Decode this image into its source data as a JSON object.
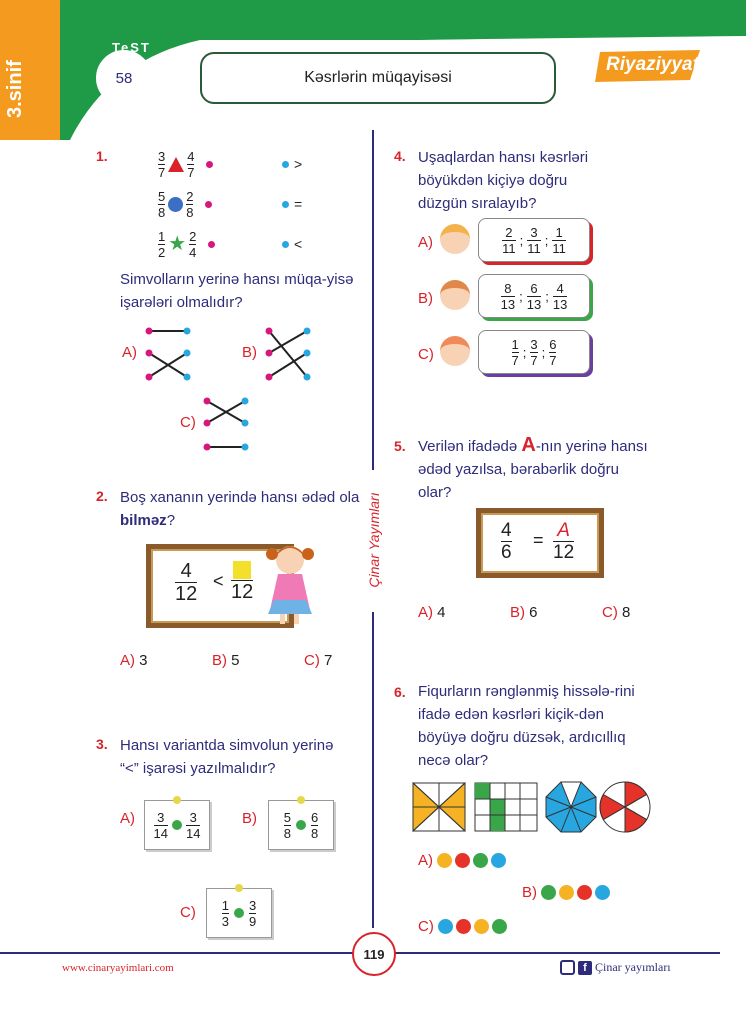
{
  "header": {
    "grade": "3.sinif",
    "test_word": "TeST",
    "test_number": "58",
    "topic": "Kəsrlərin müqayisəsi",
    "subject": "Riyaziyyat"
  },
  "side_label": "Çinar Yayımları",
  "q1": {
    "number": "1.",
    "rows": [
      {
        "l_num": "3",
        "l_den": "7",
        "r_num": "4",
        "r_den": "7",
        "shape": "triangle-icon",
        "shape_color": "#d8232a",
        "symbol": ">"
      },
      {
        "l_num": "5",
        "l_den": "8",
        "r_num": "2",
        "r_den": "8",
        "shape": "circle-icon",
        "shape_color": "#3a6fc4",
        "symbol": "="
      },
      {
        "l_num": "1",
        "l_den": "2",
        "r_num": "2",
        "r_den": "4",
        "shape": "star-icon",
        "shape_color": "#3aa64a",
        "symbol": "<"
      }
    ],
    "text": "Simvolların yerinə hansı müqa-yisə işarələri olmalıdır?",
    "options": [
      "A)",
      "B)",
      "C)"
    ]
  },
  "q2": {
    "number": "2.",
    "text_a": "Boş xananın yerində hansı ədəd ola ",
    "text_bold": "bilməz",
    "text_b": "?",
    "board": {
      "num": "4",
      "den": "12",
      "sign": "<",
      "den2": "12"
    },
    "options": [
      {
        "label": "A)",
        "value": "3"
      },
      {
        "label": "B)",
        "value": "5"
      },
      {
        "label": "C)",
        "value": "7"
      }
    ]
  },
  "q3": {
    "number": "3.",
    "text_a": "Hansı variantda simvolun yerinə",
    "text_b": "“<” işarəsi yazılmalıdır?",
    "options": [
      {
        "label": "A)",
        "l_num": "3",
        "l_den": "14",
        "r_num": "3",
        "r_den": "14"
      },
      {
        "label": "B)",
        "l_num": "5",
        "l_den": "8",
        "r_num": "6",
        "r_den": "8"
      },
      {
        "label": "C)",
        "l_num": "1",
        "l_den": "3",
        "r_num": "3",
        "r_den": "9"
      }
    ]
  },
  "q4": {
    "number": "4.",
    "text": "Uşaqlardan hansı kəsrləri böyükdən kiçiyə doğru düzgün sıralayıb?",
    "options": [
      {
        "label": "A)",
        "fracs": [
          [
            "2",
            "11"
          ],
          [
            "3",
            "11"
          ],
          [
            "1",
            "11"
          ]
        ],
        "border": "#d8232a"
      },
      {
        "label": "B)",
        "fracs": [
          [
            "8",
            "13"
          ],
          [
            "6",
            "13"
          ],
          [
            "4",
            "13"
          ]
        ],
        "border": "#3aa64a"
      },
      {
        "label": "C)",
        "fracs": [
          [
            "1",
            "7"
          ],
          [
            "3",
            "7"
          ],
          [
            "6",
            "7"
          ]
        ],
        "border": "#6a3fa0"
      }
    ],
    "separator": ";"
  },
  "q5": {
    "number": "5.",
    "text_a": "Verilən ifadədə ",
    "text_letter": "A",
    "text_b": "-nın yerinə hansı ədəd yazılsa, bərabərlik doğru olar?",
    "board": {
      "num": "4",
      "den": "6",
      "eq": "=",
      "num2": "A",
      "den2": "12"
    },
    "options": [
      {
        "label": "A)",
        "value": "4"
      },
      {
        "label": "B)",
        "value": "6"
      },
      {
        "label": "C)",
        "value": "8"
      }
    ]
  },
  "q6": {
    "number": "6.",
    "text": "Fiqurların rənglənmiş hissələ-rini ifadə edən kəsrləri kiçik-dən böyüyə doğru düzsək, ardıcıllıq necə olar?",
    "options": [
      {
        "label": "A)",
        "colors": [
          "#f5b324",
          "#e63329",
          "#3aa64a",
          "#27a6e0"
        ]
      },
      {
        "label": "B)",
        "colors": [
          "#3aa64a",
          "#f5b324",
          "#e63329",
          "#27a6e0"
        ]
      },
      {
        "label": "C)",
        "colors": [
          "#27a6e0",
          "#e63329",
          "#f5b324",
          "#3aa64a"
        ]
      }
    ]
  },
  "footer": {
    "page_number": "119",
    "website": "www.cinaryayimlari.com",
    "social": "Çinar yayımları"
  }
}
